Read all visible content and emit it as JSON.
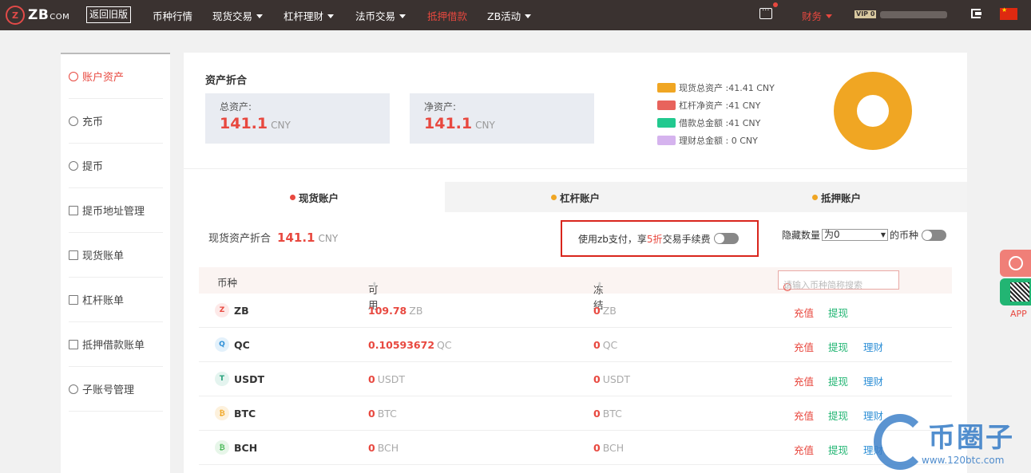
{
  "nav": {
    "logo_mark": "Z",
    "brand": "ZB",
    "brand_suffix": "COM",
    "old_version": "返回旧版",
    "items": [
      {
        "label": "币种行情",
        "caret": false,
        "active": false
      },
      {
        "label": "现货交易",
        "caret": true,
        "active": false
      },
      {
        "label": "杠杆理财",
        "caret": true,
        "active": false
      },
      {
        "label": "法币交易",
        "caret": true,
        "active": false
      },
      {
        "label": "抵押借款",
        "caret": false,
        "active": true
      },
      {
        "label": "ZB活动",
        "caret": true,
        "active": false
      }
    ],
    "finance": "财务",
    "vip": "VIP 0"
  },
  "sidebar": {
    "items": [
      {
        "label": "账户资产",
        "icon": "asset-icon",
        "active": true
      },
      {
        "label": "充币",
        "icon": "deposit-icon",
        "active": false
      },
      {
        "label": "提币",
        "icon": "withdraw-icon",
        "active": false
      },
      {
        "label": "提币地址管理",
        "icon": "address-book-icon",
        "active": false
      },
      {
        "label": "现货账单",
        "icon": "bill-icon",
        "active": false
      },
      {
        "label": "杠杆账单",
        "icon": "bill-icon",
        "active": false
      },
      {
        "label": "抵押借款账单",
        "icon": "bill-icon",
        "active": false
      },
      {
        "label": "子账号管理",
        "icon": "sub-account-icon",
        "active": false
      }
    ]
  },
  "summary": {
    "title": "资产折合",
    "total_label": "总资产:",
    "total_value": "141.1",
    "net_label": "净资产:",
    "net_value": "141.1",
    "currency": "CNY"
  },
  "legend": [
    {
      "label": "现货总资产 :41.41 CNY",
      "color": "#f0a623"
    },
    {
      "label": "杠杆净资产 :41 CNY",
      "color": "#e8635c"
    },
    {
      "label": "借款总金额 :41 CNY",
      "color": "#22c98f"
    },
    {
      "label": "理财总金额 :  0 CNY",
      "color": "#d5b3ee"
    }
  ],
  "tabs": [
    {
      "label": "现货账户",
      "dot": "#e8483f",
      "active": true
    },
    {
      "label": "杠杆账户",
      "dot": "#f0a623",
      "active": false
    },
    {
      "label": "抵押账户",
      "dot": "#f0a623",
      "active": false
    }
  ],
  "spot": {
    "label": "现货资产折合",
    "value": "141.1",
    "currency": "CNY"
  },
  "zbpay": {
    "prefix": "使用zb支付，享",
    "highlight": "5折",
    "suffix": "交易手续费"
  },
  "hide": {
    "prefix": "隐藏数量",
    "select": "为0",
    "suffix": "的币种"
  },
  "table": {
    "col_coin": "币种",
    "col_avail": "可用",
    "col_frozen": "冻结",
    "search_placeholder": "请输入币种简称搜索",
    "rows": [
      {
        "coin": "ZB",
        "avail": "109.78",
        "frozen": "0",
        "deposit": "充值",
        "withdraw": "提现",
        "finance": "",
        "icon_color": "#e8483f",
        "icon_bg": "#fde9e8",
        "glyph": "Z"
      },
      {
        "coin": "QC",
        "avail": "0.10593672",
        "frozen": "0",
        "deposit": "充值",
        "withdraw": "提现",
        "finance": "理财",
        "icon_color": "#2e8fd6",
        "icon_bg": "#e3f1fb",
        "glyph": "Q"
      },
      {
        "coin": "USDT",
        "avail": "0",
        "frozen": "0",
        "deposit": "充值",
        "withdraw": "提现",
        "finance": "理财",
        "icon_color": "#26a17b",
        "icon_bg": "#e4f4ef",
        "glyph": "T"
      },
      {
        "coin": "BTC",
        "avail": "0",
        "frozen": "0",
        "deposit": "充值",
        "withdraw": "提现",
        "finance": "理财",
        "icon_color": "#f0a623",
        "icon_bg": "#fdf1dc",
        "glyph": "₿"
      },
      {
        "coin": "BCH",
        "avail": "0",
        "frozen": "0",
        "deposit": "充值",
        "withdraw": "提现",
        "finance": "理财",
        "icon_color": "#4cba5a",
        "icon_bg": "#e7f6e9",
        "glyph": "₿"
      }
    ]
  },
  "float": {
    "app_label": "APP"
  },
  "watermark": {
    "text": "币圈子",
    "url": "www.120btc.com"
  }
}
